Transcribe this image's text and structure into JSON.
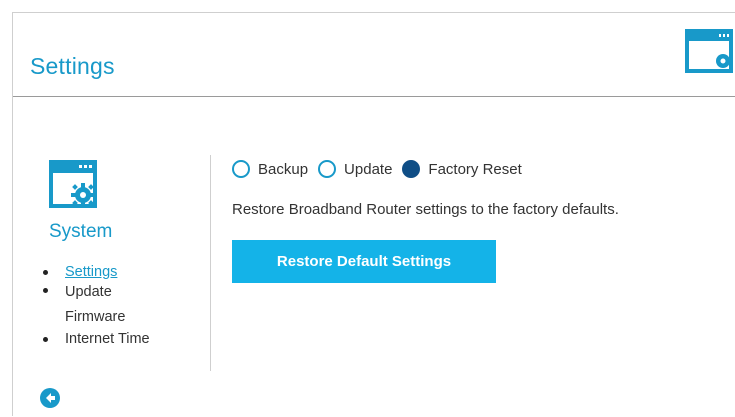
{
  "header": {
    "title": "Settings",
    "icon": "settings-window-icon"
  },
  "sidebar": {
    "section_title": "System",
    "section_icon": "system-settings-icon",
    "items": [
      {
        "label": "Settings",
        "active": true
      },
      {
        "label": "Update Firmware",
        "active": false
      },
      {
        "label": "Internet Time",
        "active": false
      }
    ],
    "back_icon": "back-arrow-icon"
  },
  "main": {
    "options": [
      {
        "label": "Backup",
        "checked": false
      },
      {
        "label": "Update",
        "checked": false
      },
      {
        "label": "Factory Reset",
        "checked": true
      }
    ],
    "description": "Restore Broadband Router settings to the factory defaults.",
    "restore_button": "Restore Default Settings"
  },
  "colors": {
    "accent": "#1899c9",
    "button": "#14b3e8",
    "radio_checked": "#0f4e86"
  }
}
